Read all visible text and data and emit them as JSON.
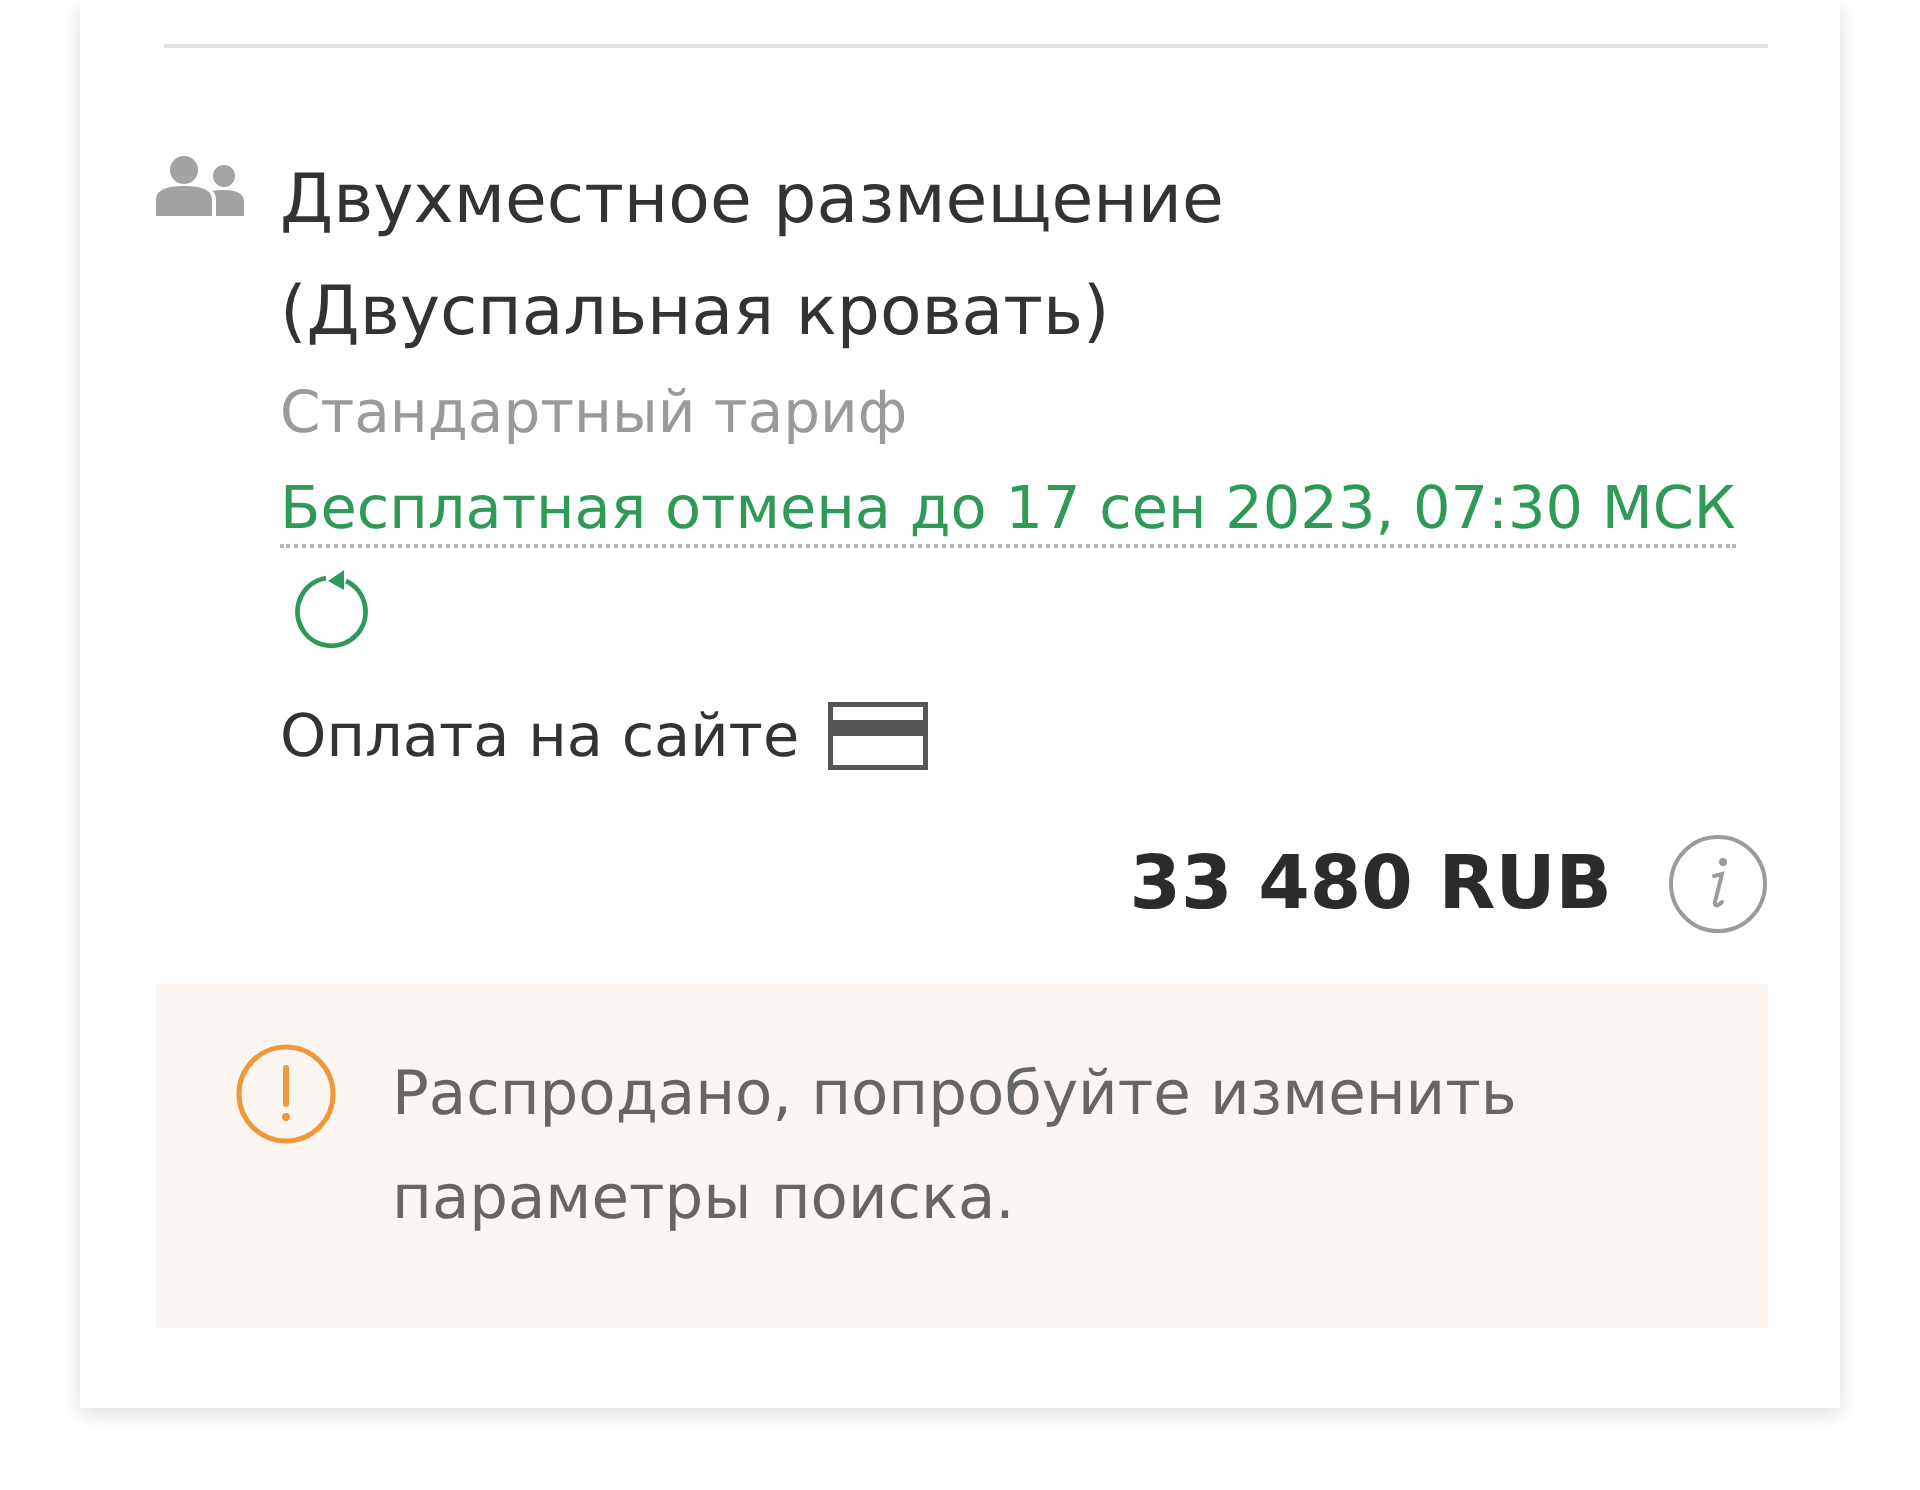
{
  "room": {
    "title": "Двухместное размещение (Двуспальная кровать)",
    "tariff": "Стандартный тариф",
    "cancellation": "Бесплатная отмена до 17 сен 2023, 07:30 МСК",
    "payment": "Оплата на сайте",
    "price": "33 480 RUB"
  },
  "alert": {
    "kind": "warning",
    "text": "Распродано, попробуйте изменить параметры поиска."
  }
}
